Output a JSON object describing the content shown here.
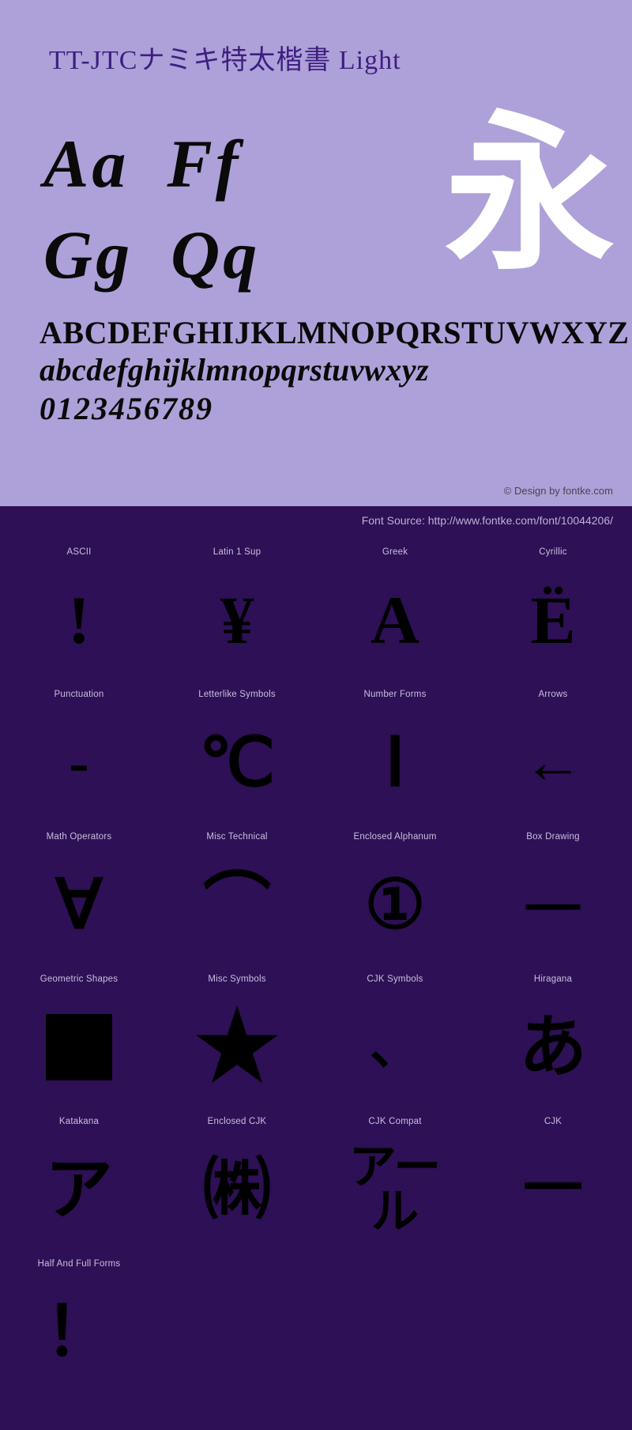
{
  "header": {
    "font_title": "TT-JTCナミキ特太楷書 Light"
  },
  "preview": {
    "pair_row_1": "Aa",
    "pair_row_1b": "Ff",
    "pair_row_2": "Gg",
    "pair_row_2b": "Qq",
    "showcase_glyph": "永",
    "uppercase": "ABCDEFGHIJKLMNOPQRSTUVWXYZ",
    "lowercase": "abcdefghijklmnopqrstuvwxyz",
    "numerals": "0123456789",
    "credit": "© Design by fontke.com"
  },
  "source": {
    "label": "Font Source: http://www.fontke.com/font/10044206/"
  },
  "colors": {
    "preview_background": "#aea1d9",
    "page_background": "#2d1055",
    "title_color": "#3d1f80",
    "glyph_color": "#000000",
    "showcase_glyph_color": "#ffffff",
    "label_color": "#c9bfe0",
    "credit_color": "#4a4450"
  },
  "grid": {
    "rows": [
      {
        "cells": [
          {
            "label": "ASCII",
            "glyph": "!",
            "style": ""
          },
          {
            "label": "Latin 1 Sup",
            "glyph": "¥",
            "style": ""
          },
          {
            "label": "Greek",
            "glyph": "Α",
            "style": ""
          },
          {
            "label": "Cyrillic",
            "glyph": "Ё",
            "style": ""
          }
        ]
      },
      {
        "cells": [
          {
            "label": "Punctuation",
            "glyph": "‐",
            "style": "shape-wide"
          },
          {
            "label": "Letterlike Symbols",
            "glyph": "℃",
            "style": ""
          },
          {
            "label": "Number Forms",
            "glyph": "Ⅰ",
            "style": ""
          },
          {
            "label": "Arrows",
            "glyph": "←",
            "style": "shape-wide"
          }
        ]
      },
      {
        "cells": [
          {
            "label": "Math Operators",
            "glyph": "∀",
            "style": ""
          },
          {
            "label": "Misc Technical",
            "glyph": "⌒",
            "style": ""
          },
          {
            "label": "Enclosed Alphanum",
            "glyph": "①",
            "style": ""
          },
          {
            "label": "Box Drawing",
            "glyph": "─",
            "style": "shape-line"
          }
        ]
      },
      {
        "cells": [
          {
            "label": "Geometric Shapes",
            "glyph": "",
            "style": "shape-square"
          },
          {
            "label": "Misc Symbols",
            "glyph": "★",
            "style": "shape-star"
          },
          {
            "label": "CJK Symbols",
            "glyph": "、",
            "style": "shape-small"
          },
          {
            "label": "Hiragana",
            "glyph": "あ",
            "style": ""
          }
        ]
      },
      {
        "cells": [
          {
            "label": "Katakana",
            "glyph": "ア",
            "style": ""
          },
          {
            "label": "Enclosed CJK",
            "glyph": "㈱",
            "style": ""
          },
          {
            "label": "CJK Compat",
            "glyph": "アール",
            "style": "shape-stack"
          },
          {
            "label": "CJK",
            "glyph": "一",
            "style": "shape-wide"
          }
        ]
      },
      {
        "cells": [
          {
            "label": "Half And Full Forms",
            "glyph": "！",
            "style": ""
          },
          {
            "label": "",
            "glyph": "",
            "style": ""
          },
          {
            "label": "",
            "glyph": "",
            "style": ""
          },
          {
            "label": "",
            "glyph": "",
            "style": ""
          }
        ]
      }
    ]
  }
}
